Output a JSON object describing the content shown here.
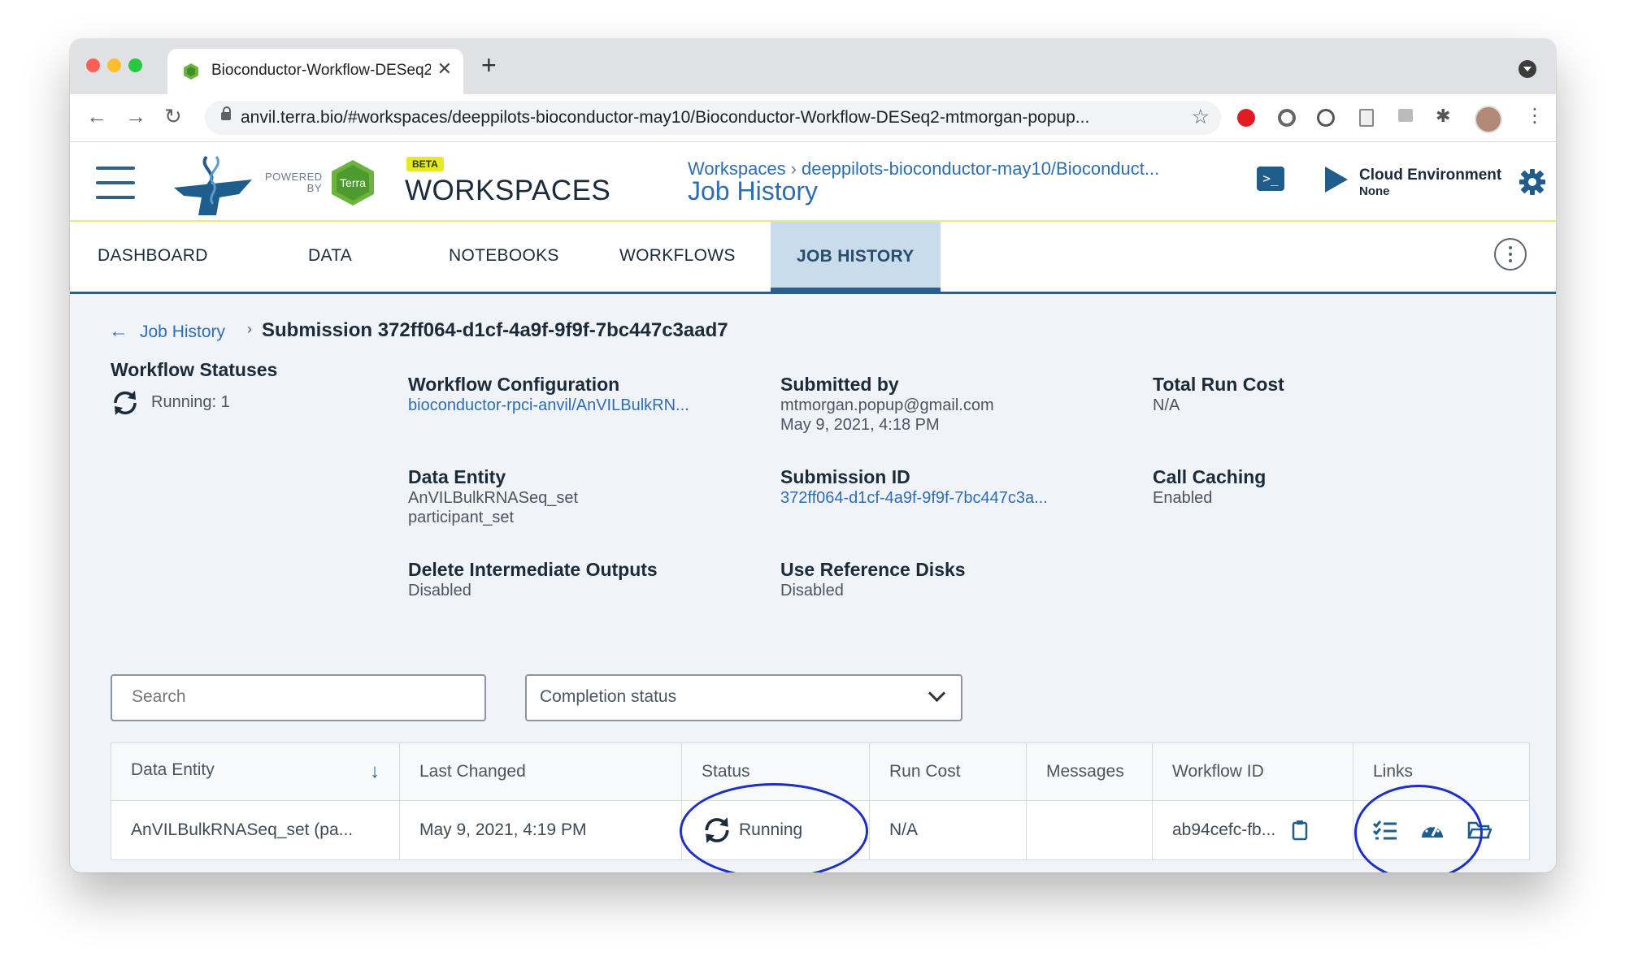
{
  "browser": {
    "tab_title": "Bioconductor-Workflow-DESeq2",
    "url": "anvil.terra.bio/#workspaces/deeppilots-bioconductor-may10/Bioconductor-Workflow-DESeq2-mtmorgan-popup..."
  },
  "header": {
    "powered_by": "POWERED BY",
    "terra_badge": "Terra",
    "beta": "BETA",
    "app_title": "WORKSPACES",
    "breadcrumb": [
      "Workspaces",
      "deeppilots-bioconductor-may10/Bioconduct..."
    ],
    "page_heading": "Job History",
    "cloud_env_title": "Cloud Environment",
    "cloud_env_status": "None"
  },
  "nav_tabs": [
    "DASHBOARD",
    "DATA",
    "NOTEBOOKS",
    "WORKFLOWS",
    "JOB HISTORY"
  ],
  "submission": {
    "back_link": "Job History",
    "title": "Submission 372ff064-d1cf-4a9f-9f9f-7bc447c3aad7",
    "workflow_statuses_label": "Workflow Statuses",
    "running_count": "Running: 1",
    "workflow_configuration_label": "Workflow Configuration",
    "workflow_configuration_value": "bioconductor-rpci-anvil/AnVILBulkRN...",
    "submitted_by_label": "Submitted by",
    "submitted_by_email": "mtmorgan.popup@gmail.com",
    "submitted_date": "May 9, 2021, 4:18 PM",
    "total_run_cost_label": "Total Run Cost",
    "total_run_cost_value": "N/A",
    "data_entity_label": "Data Entity",
    "data_entity_value": "AnVILBulkRNASeq_set",
    "data_entity_type": "participant_set",
    "submission_id_label": "Submission ID",
    "submission_id_value": "372ff064-d1cf-4a9f-9f9f-7bc447c3a...",
    "call_caching_label": "Call Caching",
    "call_caching_value": "Enabled",
    "delete_outputs_label": "Delete Intermediate Outputs",
    "delete_outputs_value": "Disabled",
    "ref_disks_label": "Use Reference Disks",
    "ref_disks_value": "Disabled"
  },
  "filters": {
    "search_placeholder": "Search",
    "completion_status": "Completion status"
  },
  "table": {
    "headers": [
      "Data Entity",
      "Last Changed",
      "Status",
      "Run Cost",
      "Messages",
      "Workflow ID",
      "Links"
    ],
    "rows": [
      {
        "data_entity": "AnVILBulkRNASeq_set (pa...",
        "last_changed": "May 9, 2021, 4:19 PM",
        "status": "Running",
        "run_cost": "N/A",
        "messages": "",
        "workflow_id": "ab94cefc-fb..."
      }
    ]
  },
  "colors": {
    "terra_blue": "#2f6db2",
    "nav_blue": "#2a5f8f",
    "accent_yellow": "#e5eb74",
    "annotation_circle": "#1c2fc8"
  }
}
